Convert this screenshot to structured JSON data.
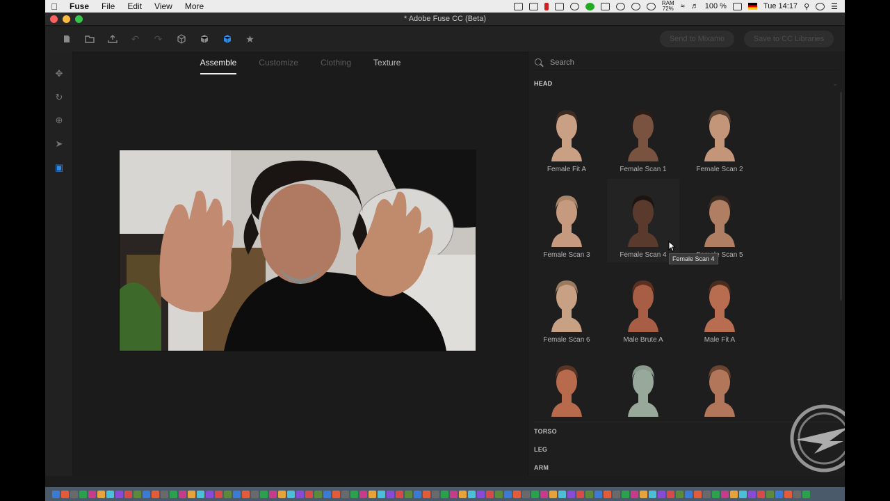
{
  "menubar": {
    "app_name": "Fuse",
    "items": [
      "File",
      "Edit",
      "View",
      "More"
    ],
    "ram_label": "RAM",
    "ram_value": "72%",
    "battery": "100 %",
    "clock": "Tue 14:17"
  },
  "window": {
    "title": "* Adobe Fuse CC (Beta)"
  },
  "toolbar": {
    "send_label": "Send to Mixamo",
    "save_label": "Save to CC Libraries"
  },
  "tabs": [
    {
      "label": "Assemble",
      "state": "active"
    },
    {
      "label": "Customize",
      "state": "disabled"
    },
    {
      "label": "Clothing",
      "state": "disabled"
    },
    {
      "label": "Texture",
      "state": "normal"
    }
  ],
  "panel": {
    "search_placeholder": "Search",
    "sections": {
      "head": "HEAD",
      "torso": "TORSO",
      "leg": "LEG",
      "arm": "ARM"
    },
    "items": [
      {
        "label": "Female Fit A",
        "skin": "#caa084",
        "hair": "#3a2a20"
      },
      {
        "label": "Female Scan 1",
        "skin": "#7a5240",
        "hair": "#2a1c16"
      },
      {
        "label": "Female Scan 2",
        "skin": "#c49679",
        "hair": "#5a4232"
      },
      {
        "label": "Female Scan 3",
        "skin": "#c69a7e",
        "hair": "#a88566"
      },
      {
        "label": "Female Scan 4",
        "skin": "#5a3a2c",
        "hair": "#1c1410"
      },
      {
        "label": "Female Scan 5",
        "skin": "#b07e62",
        "hair": "#3a2a20"
      },
      {
        "label": "Female Scan 6",
        "skin": "#c8a084",
        "hair": "#9a7a5e"
      },
      {
        "label": "Male Brute A",
        "skin": "#a85e44",
        "hair": "#5a3020"
      },
      {
        "label": "Male Fit A",
        "skin": "#b86c50",
        "hair": "#4a2c1e"
      },
      {
        "label": "",
        "skin": "#b86a4c",
        "hair": "#5a3424"
      },
      {
        "label": "",
        "skin": "#98a89a",
        "hair": "#8a9a8c"
      },
      {
        "label": "",
        "skin": "#b2765a",
        "hair": "#6a4430"
      }
    ],
    "tooltip": "Female Scan 4"
  },
  "colors": {
    "accent": "#2d8ceb"
  }
}
